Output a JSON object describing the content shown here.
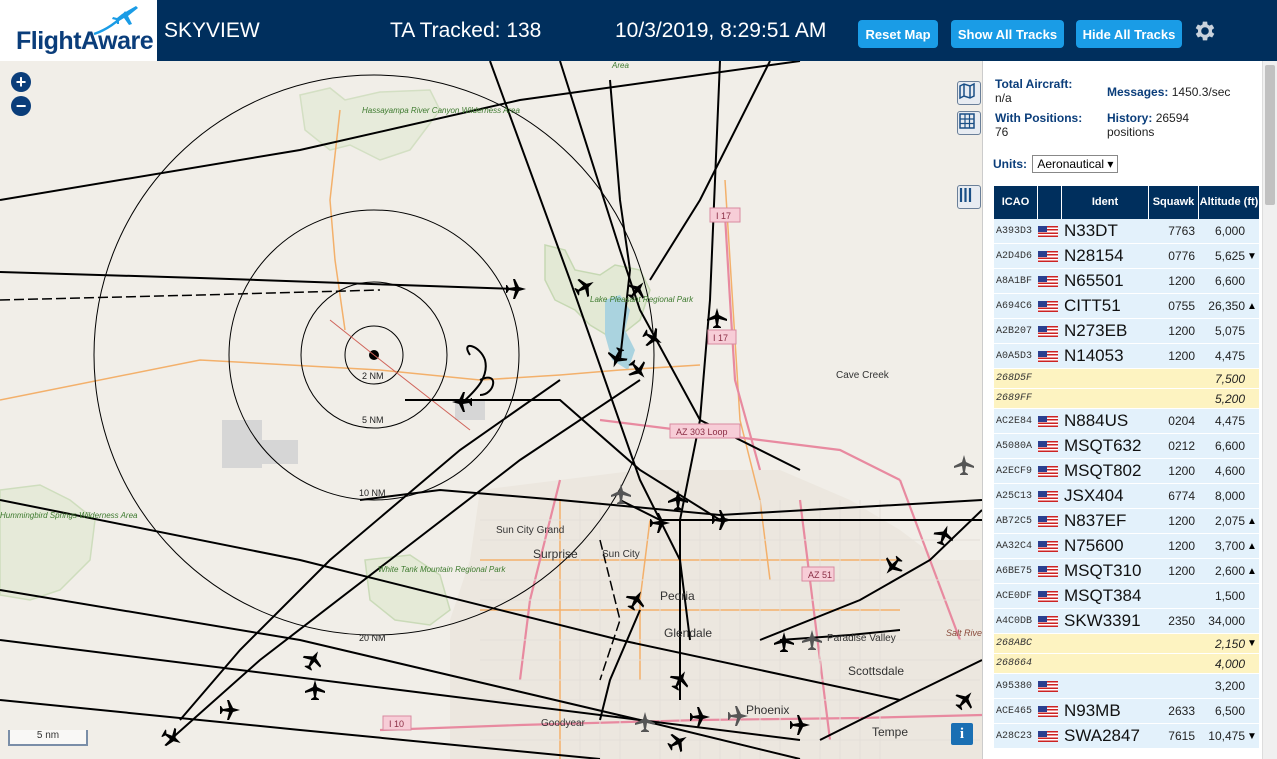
{
  "header": {
    "logo_text": "FlightAware",
    "title": "SKYVIEW",
    "tracked": "TA Tracked: 138",
    "clock": "10/3/2019, 8:29:51 AM",
    "reset_map": "Reset Map",
    "show_all": "Show All Tracks",
    "hide_all": "Hide All Tracks"
  },
  "map": {
    "zoom_in": "+",
    "zoom_out": "−",
    "scale": "5 nm",
    "info": "i",
    "range_labels": [
      "2 NM",
      "5 NM",
      "10 NM",
      "20 NM"
    ],
    "places": [
      "Hassayampa River Canyon Wilderness Area",
      "Lake Pleasant Regional Park",
      "Cave Creek",
      "Sun City Grand",
      "Surprise",
      "Sun City",
      "White Tank Mountain Regional Park",
      "Peoria",
      "Glendale",
      "Paradise Valley",
      "Scottsdale",
      "Phoenix",
      "Goodyear",
      "Tempe",
      "Hummingbird Springs Wilderness Area",
      "Salt River Pima Maricopa Indian Community",
      "Area"
    ],
    "roads": [
      "I 17",
      "I 17",
      "AZ 303 Loop",
      "AZ 51",
      "I 10"
    ]
  },
  "panel": {
    "total_label": "Total Aircraft:",
    "total_value": "n/a",
    "messages_label": "Messages:",
    "messages_value": "1450.3/sec",
    "positions_label": "With Positions:",
    "positions_value": "76",
    "history_label": "History:",
    "history_value": "26594 positions",
    "units_label": "Units:",
    "units_value": "Aeronautical ▾",
    "columns": [
      "ICAO",
      "",
      "Ident",
      "Squawk",
      "Altitude (ft)"
    ]
  },
  "rows": [
    {
      "icao": "A393D3",
      "flag": true,
      "ident": "N33DT",
      "squawk": "7763",
      "alt": "6,000",
      "trend": ""
    },
    {
      "icao": "A2D4D6",
      "flag": true,
      "ident": "N28154",
      "squawk": "0776",
      "alt": "5,625",
      "trend": "▼"
    },
    {
      "icao": "A8A1BF",
      "flag": true,
      "ident": "N65501",
      "squawk": "1200",
      "alt": "6,600",
      "trend": ""
    },
    {
      "icao": "A694C6",
      "flag": true,
      "ident": "CITT51",
      "squawk": "0755",
      "alt": "26,350",
      "trend": "▲"
    },
    {
      "icao": "A2B207",
      "flag": true,
      "ident": "N273EB",
      "squawk": "1200",
      "alt": "5,075",
      "trend": ""
    },
    {
      "icao": "A0A5D3",
      "flag": true,
      "ident": "N14053",
      "squawk": "1200",
      "alt": "4,475",
      "trend": ""
    },
    {
      "icao": "268D5F",
      "flag": false,
      "ident": "",
      "squawk": "",
      "alt": "7,500",
      "trend": "",
      "tisb": true
    },
    {
      "icao": "2689FF",
      "flag": false,
      "ident": "",
      "squawk": "",
      "alt": "5,200",
      "trend": "",
      "tisb": true
    },
    {
      "icao": "AC2E84",
      "flag": true,
      "ident": "N884US",
      "squawk": "0204",
      "alt": "4,475",
      "trend": ""
    },
    {
      "icao": "A5080A",
      "flag": true,
      "ident": "MSQT632",
      "squawk": "0212",
      "alt": "6,600",
      "trend": ""
    },
    {
      "icao": "A2ECF9",
      "flag": true,
      "ident": "MSQT802",
      "squawk": "1200",
      "alt": "4,600",
      "trend": ""
    },
    {
      "icao": "A25C13",
      "flag": true,
      "ident": "JSX404",
      "squawk": "6774",
      "alt": "8,000",
      "trend": ""
    },
    {
      "icao": "AB72C5",
      "flag": true,
      "ident": "N837EF",
      "squawk": "1200",
      "alt": "2,075",
      "trend": "▲"
    },
    {
      "icao": "AA32C4",
      "flag": true,
      "ident": "N75600",
      "squawk": "1200",
      "alt": "3,700",
      "trend": "▲"
    },
    {
      "icao": "A6BE75",
      "flag": true,
      "ident": "MSQT310",
      "squawk": "1200",
      "alt": "2,600",
      "trend": "▲"
    },
    {
      "icao": "ACE0DF",
      "flag": true,
      "ident": "MSQT384",
      "squawk": "",
      "alt": "1,500",
      "trend": ""
    },
    {
      "icao": "A4C0DB",
      "flag": true,
      "ident": "SKW3391",
      "squawk": "2350",
      "alt": "34,000",
      "trend": ""
    },
    {
      "icao": "268ABC",
      "flag": false,
      "ident": "",
      "squawk": "",
      "alt": "2,150",
      "trend": "▼",
      "tisb": true
    },
    {
      "icao": "268664",
      "flag": false,
      "ident": "",
      "squawk": "",
      "alt": "4,000",
      "trend": "",
      "tisb": true
    },
    {
      "icao": "A95380",
      "flag": true,
      "ident": "",
      "squawk": "",
      "alt": "3,200",
      "trend": ""
    },
    {
      "icao": "ACE465",
      "flag": true,
      "ident": "N93MB",
      "squawk": "2633",
      "alt": "6,500",
      "trend": ""
    },
    {
      "icao": "A28C23",
      "flag": true,
      "ident": "SWA2847",
      "squawk": "7615",
      "alt": "10,475",
      "trend": "▼"
    }
  ]
}
